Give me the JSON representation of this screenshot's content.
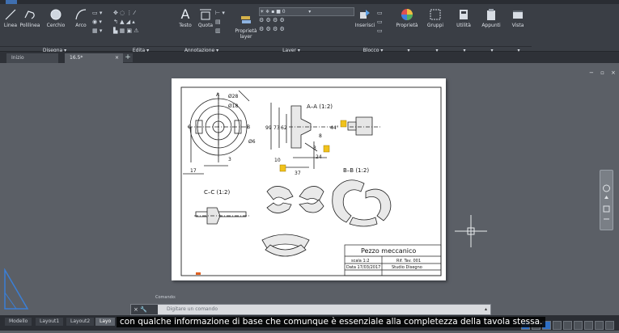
{
  "ribbon": {
    "tools": {
      "linea": "Linea",
      "polilinea": "Polilinea",
      "cerchio": "Cerchio",
      "arco": "Arco",
      "testo": "Testo",
      "quota": "Quota",
      "proprieta_layer": "Proprietà layer",
      "inserisci": "Inserisci",
      "proprieta": "Proprietà",
      "gruppi": "Gruppi",
      "utilita": "Utilità",
      "appunti": "Appunti",
      "vista": "Vista"
    },
    "panels": {
      "disegna": "Disegna",
      "edita": "Edita",
      "annotazione": "Annotazione",
      "layer": "Layer",
      "blocco": "Blocco"
    }
  },
  "tabs": {
    "start": "Inizio",
    "drawing": "16.5*"
  },
  "drawing": {
    "view_aa": "A–A (1:2)",
    "view_bb": "B–B (1:2)",
    "view_cc": "C–C (1:2)",
    "dim_28": "Ø28",
    "dim_18": "Ø18",
    "dim_6": "Ø6",
    "dim_99": "99",
    "dim_73": "73",
    "dim_62": "62",
    "dim_44": "44°",
    "dim_8": "8",
    "dim_3a": "3",
    "dim_3b": "3",
    "dim_24": "24",
    "dim_10": "10",
    "dim_37": "37",
    "dim_17": "17",
    "label_a": "A",
    "label_b": "B",
    "label_c": "C",
    "title_block": {
      "title": "Pezzo meccanico",
      "scale": "scala 1:2",
      "ref": "Rif. Tav. 001",
      "date": "Data 17/03/2017",
      "author": "Studio Disegno"
    }
  },
  "command": {
    "history_label": "Comando:",
    "placeholder": "Digitare un comando"
  },
  "statusbar": {
    "model": "Modello",
    "layout1": "Layout1",
    "layout2": "Layout2",
    "layout3": "Layo"
  },
  "subtitle": "con qualche informazione di base che comunque è essenziale alla completezza della tavola stessa."
}
